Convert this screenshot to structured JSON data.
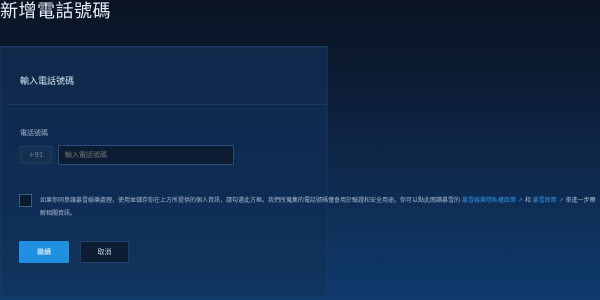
{
  "page": {
    "title": "新增電話號碼"
  },
  "form": {
    "heading": "輸入電話號碼",
    "phone_label": "電話號碼",
    "country_code": "+91",
    "phone_placeholder": "輸入電話號碼",
    "consent": {
      "text_before": "如果你同意讓暴雪娛樂處理，使用並儲存你在上方所提供的個人資訊，請勾選此方框。我們所蒐集的電話號碼僅會用於驗證和安全用途。你可以點此閱讀暴雪的",
      "link_privacy": "暴雪娛樂隱私權政策",
      "text_middle": "和",
      "link_cookie": "暴雪政策",
      "text_after": "來進一步瞭解相關資訊。"
    },
    "submit_label": "繼續",
    "cancel_label": "取消"
  },
  "colors": {
    "accent": "#1f8fe0",
    "link": "#2f93e2"
  },
  "icons": {
    "external_link": "external-link-icon"
  }
}
